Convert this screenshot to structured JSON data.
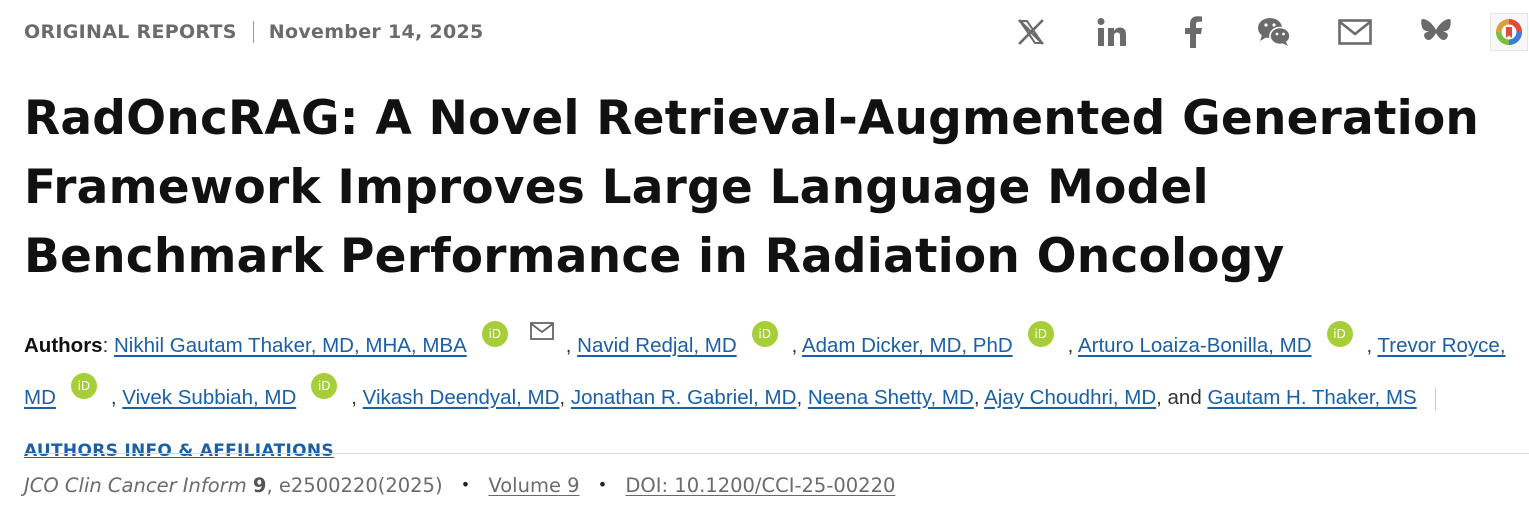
{
  "header": {
    "section_label": "ORIGINAL REPORTS",
    "date": "November 14, 2025"
  },
  "share": [
    {
      "name": "x-icon",
      "label": "X"
    },
    {
      "name": "linkedin-icon",
      "label": "LinkedIn"
    },
    {
      "name": "facebook-icon",
      "label": "Facebook"
    },
    {
      "name": "wechat-icon",
      "label": "WeChat"
    },
    {
      "name": "email-icon",
      "label": "Email"
    },
    {
      "name": "bluesky-icon",
      "label": "Bluesky"
    },
    {
      "name": "altmetric-icon",
      "label": "Altmetric"
    }
  ],
  "article": {
    "title": "RadOncRAG: A Novel Retrieval-Augmented Generation Framework Improves Large Language Model Benchmark Performance in Radiation Oncology"
  },
  "authors": {
    "label": "Authors",
    "colon": ": ",
    "list": [
      "Nikhil Gautam Thaker, MD, MHA, MBA",
      "Navid Redjal, MD",
      "Adam Dicker, MD, PhD",
      "Arturo Loaiza-Bonilla, MD",
      "Trevor Royce, MD",
      "Vivek Subbiah, MD",
      "Vikash Deendyal, MD",
      "Jonathan R. Gabriel, MD",
      "Neena Shetty, MD",
      "Ajay Choudhri, MD",
      "Gautam H. Thaker, MS"
    ],
    "comma": ", ",
    "and": ", and ",
    "orcid_text": "iD",
    "info_link": "AUTHORS INFO & AFFILIATIONS"
  },
  "citation": {
    "journal": "JCO Clin Cancer Inform",
    "volume_num": "9",
    "article_id": ", e2500220(2025)",
    "bullet": "•",
    "volume_link": "Volume 9",
    "doi_link": "DOI: 10.1200/CCI-25-00220"
  },
  "colors": {
    "link": "#1b5fa5",
    "orcid": "#a6ce39",
    "muted": "#6b6b6b"
  }
}
